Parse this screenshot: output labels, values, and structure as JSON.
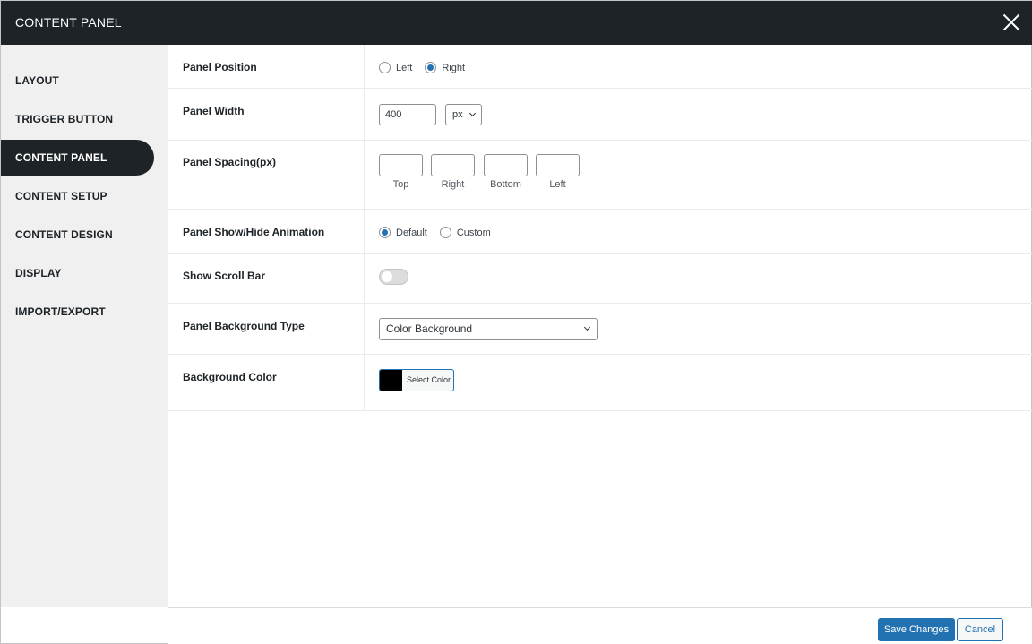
{
  "header": {
    "title": "CONTENT PANEL"
  },
  "sidebar": {
    "items": [
      {
        "label": "LAYOUT"
      },
      {
        "label": "TRIGGER BUTTON"
      },
      {
        "label": "CONTENT PANEL",
        "active": true
      },
      {
        "label": "CONTENT SETUP"
      },
      {
        "label": "CONTENT DESIGN"
      },
      {
        "label": "DISPLAY"
      },
      {
        "label": "IMPORT/EXPORT"
      }
    ]
  },
  "settings": {
    "panel_position": {
      "label": "Panel Position",
      "options": [
        "Left",
        "Right"
      ],
      "selected": "Right"
    },
    "panel_width": {
      "label": "Panel Width",
      "value": "400",
      "unit": "px"
    },
    "panel_spacing": {
      "label": "Panel Spacing(px)",
      "fields": [
        "Top",
        "Right",
        "Bottom",
        "Left"
      ]
    },
    "animation": {
      "label": "Panel Show/Hide Animation",
      "options": [
        "Default",
        "Custom"
      ],
      "selected": "Default"
    },
    "scroll_bar": {
      "label": "Show Scroll Bar",
      "enabled": false
    },
    "bg_type": {
      "label": "Panel Background Type",
      "value": "Color Background"
    },
    "bg_color": {
      "label": "Background Color",
      "button_label": "Select Color",
      "color": "#000000"
    }
  },
  "footer": {
    "save_label": "Save Changes",
    "cancel_label": "Cancel"
  },
  "colors": {
    "header_bg": "#1d2327",
    "accent": "#2271b1",
    "sidebar_bg": "#f0f0f1"
  }
}
